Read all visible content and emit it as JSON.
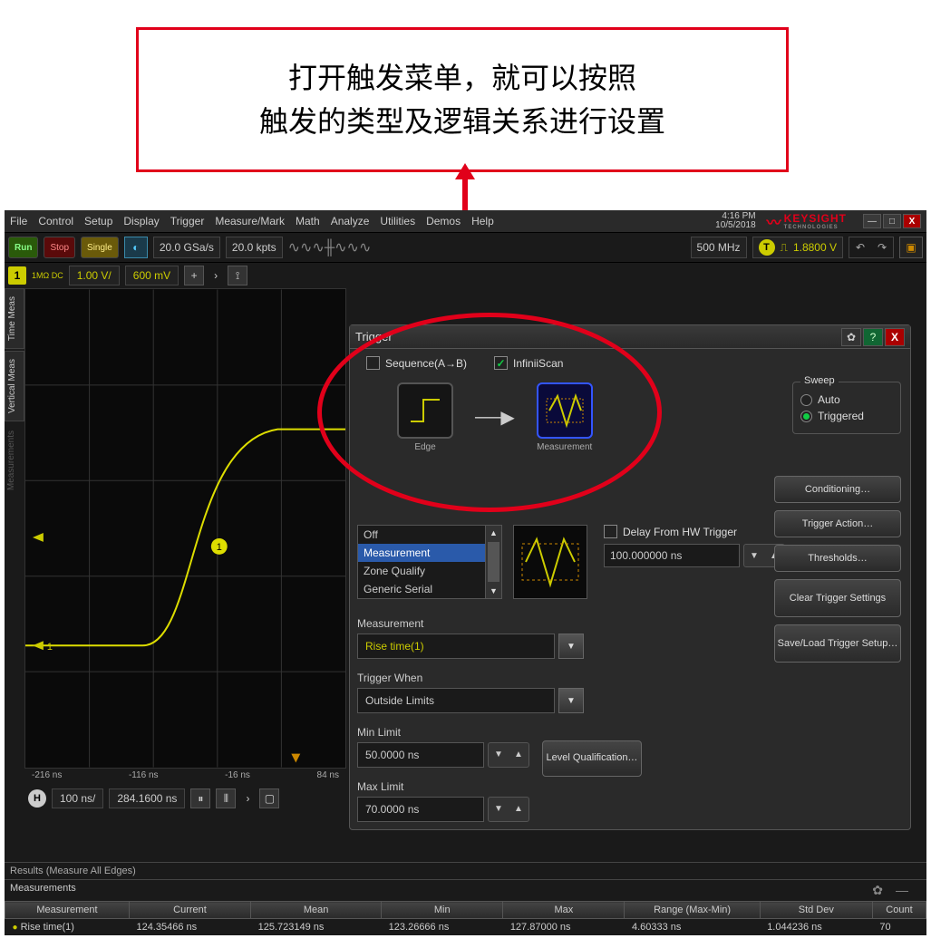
{
  "callout": {
    "line1": "打开触发菜单，就可以按照",
    "line2": "触发的类型及逻辑关系进行设置"
  },
  "menubar": {
    "items": [
      "File",
      "Control",
      "Setup",
      "Display",
      "Trigger",
      "Measure/Mark",
      "Math",
      "Analyze",
      "Utilities",
      "Demos",
      "Help"
    ],
    "time": "4:16 PM",
    "date": "10/5/2018",
    "brand": "KEYSIGHT",
    "brand_sub": "TECHNOLOGIES"
  },
  "toolbar": {
    "run": "Run",
    "stop": "Stop",
    "single": "Single",
    "sample_rate": "20.0 GSa/s",
    "mem_depth": "20.0 kpts",
    "bw": "500 MHz",
    "trig_level": "1.8800 V"
  },
  "channel": {
    "num": "1",
    "coupling": "1MΩ\nDC",
    "scale": "1.00 V/",
    "offset": "600 mV"
  },
  "side": {
    "tab1": "Time Meas",
    "tab2": "Vertical Meas",
    "tab3": "Measurements"
  },
  "horiz": {
    "ticks": [
      "-216 ns",
      "-116 ns",
      "-16 ns",
      "84 ns"
    ],
    "scale": "100 ns/",
    "pos": "284.1600 ns"
  },
  "trigger": {
    "title": "Trigger",
    "chk_sequence": "Sequence(A→B)",
    "chk_infiniiScan": "InfiniiScan",
    "flow": {
      "edge": "Edge",
      "measurement": "Measurement"
    },
    "list": [
      "Off",
      "Measurement",
      "Zone Qualify",
      "Generic Serial"
    ],
    "list_selected": "Measurement",
    "delay_label": "Delay From HW Trigger",
    "delay_value": "100.000000 ns",
    "fg_measurement": {
      "label": "Measurement",
      "value": "Rise time(1)"
    },
    "fg_trigger_when": {
      "label": "Trigger When",
      "value": "Outside Limits"
    },
    "fg_min": {
      "label": "Min Limit",
      "value": "50.0000 ns"
    },
    "fg_max": {
      "label": "Max Limit",
      "value": "70.0000 ns"
    },
    "level_btn": "Level Qualification…",
    "sweep": {
      "legend": "Sweep",
      "auto": "Auto",
      "triggered": "Triggered"
    },
    "buttons": {
      "conditioning": "Conditioning…",
      "action": "Trigger Action…",
      "thresholds": "Thresholds…",
      "clear": "Clear Trigger Settings",
      "saveload": "Save/Load Trigger Setup…"
    }
  },
  "results": {
    "label": "Results  (Measure All Edges)",
    "section": "Measurements",
    "headers": [
      "Measurement",
      "Current",
      "Mean",
      "Min",
      "Max",
      "Range (Max-Min)",
      "Std Dev",
      "Count"
    ],
    "row": {
      "name": "Rise time(1)",
      "current": "124.35466 ns",
      "mean": "125.723149 ns",
      "min": "123.26666 ns",
      "max": "127.87000 ns",
      "range": "4.60333 ns",
      "std": "1.044236 ns",
      "count": "70"
    }
  }
}
